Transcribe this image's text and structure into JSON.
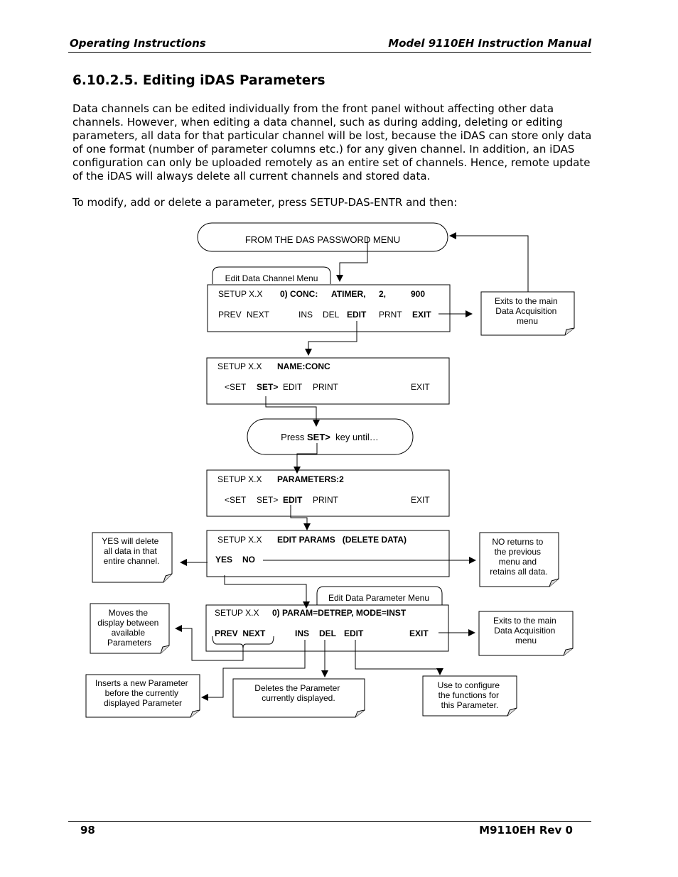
{
  "header": {
    "left": "Operating Instructions",
    "right": "Model 9110EH Instruction Manual"
  },
  "section": {
    "title": "6.10.2.5. Editing iDAS Parameters",
    "paragraphs": [
      "Data channels can be edited individually from the front panel without affecting other data channels. However, when editing a data channel, such as during adding, deleting or editing parameters, all data for that particular channel will be lost, because the iDAS can store only data of one format (number of parameter columns etc.) for any given channel. In addition, an iDAS configuration can only be uploaded remotely as an entire set of channels. Hence, remote update of the iDAS will always delete all current channels and stored data.",
      "To modify, add or delete a parameter, press SETUP-DAS-ENTR and then:"
    ]
  },
  "diagram": {
    "start": "FROM THE DAS PASSWORD MENU",
    "channel_menu": {
      "tab": "Edit Data Channel Menu",
      "line1": [
        "SETUP X.X",
        "0) CONC:",
        "ATIMER,",
        "2,",
        "900"
      ],
      "line2": [
        "PREV",
        "NEXT",
        "INS",
        "DEL",
        "EDIT",
        "PRNT",
        "EXIT"
      ]
    },
    "name_screen": {
      "line1": [
        "SETUP X.X",
        "NAME:CONC"
      ],
      "line2": [
        "<SET",
        "SET>",
        "EDIT",
        "PRINT",
        "EXIT"
      ]
    },
    "press_set": [
      "Press ",
      "SET>",
      "  key until…"
    ],
    "params_screen": {
      "line1": [
        "SETUP X.X",
        "PARAMETERS:2"
      ],
      "line2": [
        "<SET",
        "SET>",
        "EDIT",
        "PRINT",
        "EXIT"
      ]
    },
    "edit_params_screen": {
      "line1": [
        "SETUP X.X",
        "EDIT PARAMS   (DELETE DATA)"
      ],
      "line2": [
        "YES",
        "NO"
      ]
    },
    "param_menu": {
      "tab": "Edit Data Parameter Menu",
      "line1": [
        "SETUP X.X",
        "0) PARAM=DETREP, MODE=INST"
      ],
      "line2": [
        "PREV  NEXT",
        "INS",
        "DEL",
        "EDIT",
        "EXIT"
      ]
    },
    "notes": {
      "exit_main_1": [
        "Exits to the main",
        "Data Acquisition",
        "menu"
      ],
      "yes_delete": [
        "YES will delete",
        "all data in that",
        "entire channel."
      ],
      "no_returns": [
        "NO returns to",
        "the previous",
        "menu and",
        "retains all data."
      ],
      "moves_display": [
        "Moves the",
        "display between",
        "available",
        "Parameters"
      ],
      "exit_main_2": [
        "Exits to the main",
        "Data Acquisition",
        "menu"
      ],
      "inserts": [
        "Inserts a new Parameter",
        "before the currently",
        "displayed Parameter"
      ],
      "deletes": [
        "Deletes the Parameter",
        "currently displayed."
      ],
      "configure": [
        "Use to configure",
        "the functions for",
        "this Parameter."
      ]
    }
  },
  "footer": {
    "page": "98",
    "rev": "M9110EH Rev 0"
  }
}
